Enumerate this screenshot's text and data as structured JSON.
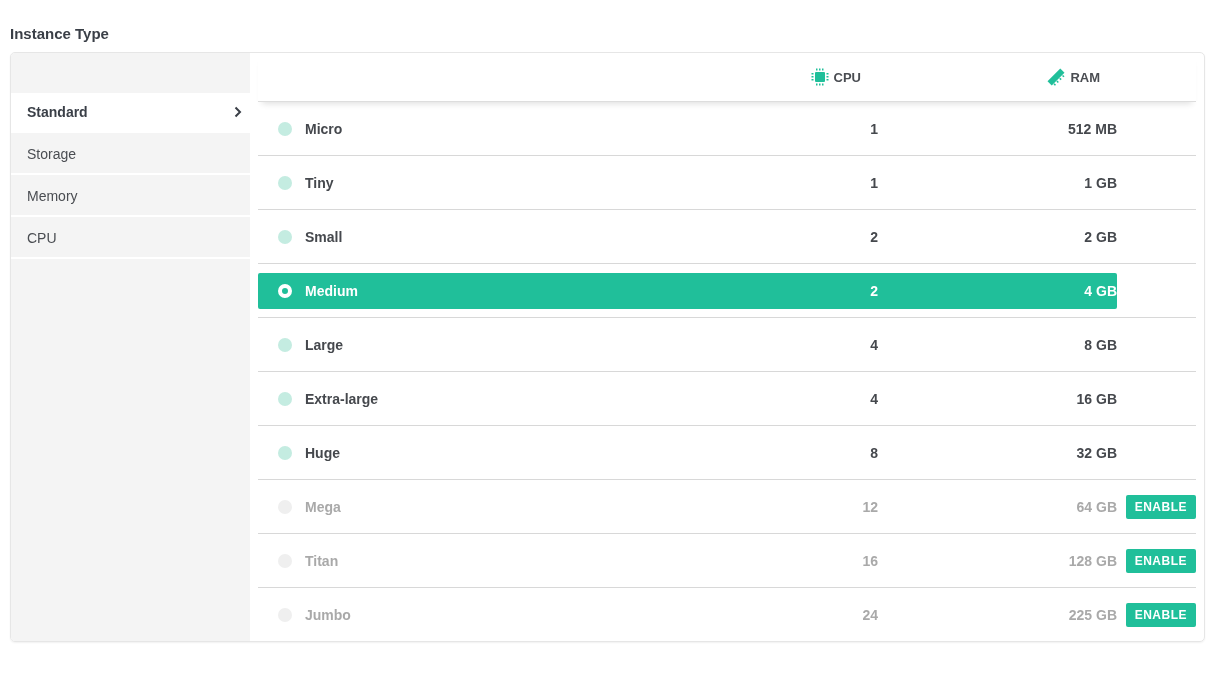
{
  "title": "Instance Type",
  "categories": [
    {
      "label": "Standard",
      "selected": true
    },
    {
      "label": "Storage",
      "selected": false
    },
    {
      "label": "Memory",
      "selected": false
    },
    {
      "label": "CPU",
      "selected": false
    }
  ],
  "columns": {
    "cpu": "CPU",
    "ram": "RAM"
  },
  "instances": [
    {
      "name": "Micro",
      "cpu": "1",
      "ram": "512 MB",
      "selected": false,
      "disabled": false
    },
    {
      "name": "Tiny",
      "cpu": "1",
      "ram": "1 GB",
      "selected": false,
      "disabled": false
    },
    {
      "name": "Small",
      "cpu": "2",
      "ram": "2 GB",
      "selected": false,
      "disabled": false
    },
    {
      "name": "Medium",
      "cpu": "2",
      "ram": "4 GB",
      "selected": true,
      "disabled": false
    },
    {
      "name": "Large",
      "cpu": "4",
      "ram": "8 GB",
      "selected": false,
      "disabled": false
    },
    {
      "name": "Extra-large",
      "cpu": "4",
      "ram": "16 GB",
      "selected": false,
      "disabled": false
    },
    {
      "name": "Huge",
      "cpu": "8",
      "ram": "32 GB",
      "selected": false,
      "disabled": false
    },
    {
      "name": "Mega",
      "cpu": "12",
      "ram": "64 GB",
      "selected": false,
      "disabled": true,
      "action": "ENABLE"
    },
    {
      "name": "Titan",
      "cpu": "16",
      "ram": "128 GB",
      "selected": false,
      "disabled": true,
      "action": "ENABLE"
    },
    {
      "name": "Jumbo",
      "cpu": "24",
      "ram": "225 GB",
      "selected": false,
      "disabled": true,
      "action": "ENABLE"
    }
  ]
}
